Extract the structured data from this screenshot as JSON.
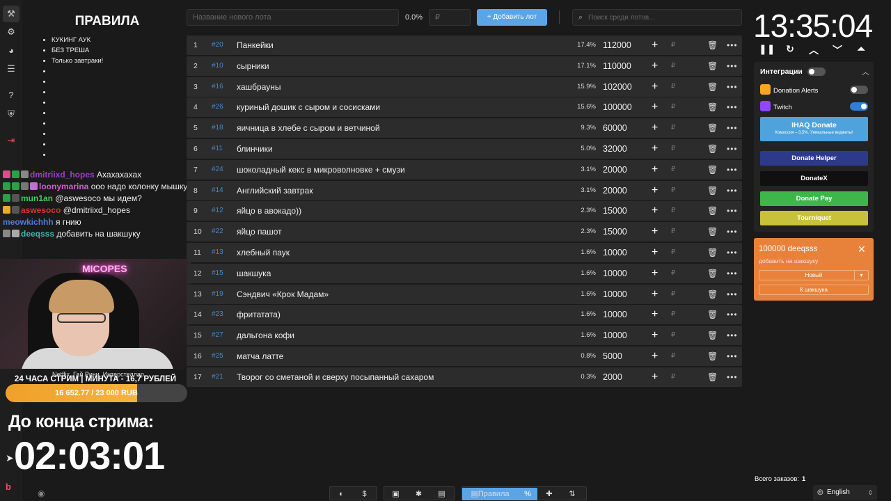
{
  "rail": [
    "hammer-icon",
    "gear-icon",
    "pie-chart-icon",
    "layers-icon",
    "help-icon",
    "shield-icon",
    "logout-icon"
  ],
  "rules": {
    "title": "ПРАВИЛА",
    "items": [
      "КУКИНГ АУК",
      "БЕЗ ТРЕША",
      "Только завтраки!",
      "",
      "",
      "",
      "",
      "",
      "",
      "",
      "",
      ""
    ]
  },
  "chat": [
    {
      "nick": "dmitriixd_hopes",
      "nick_color": "#9b3fc9",
      "text": "Ахахахахах",
      "badges": [
        "#e04b8a",
        "#2aa145",
        "#888888"
      ]
    },
    {
      "nick": "loonymarina",
      "nick_color": "#d05cd6",
      "text": "ооо надо колонку мышку",
      "badges": [
        "#2aa145",
        "#2aa145",
        "#777777",
        "#c070d0"
      ]
    },
    {
      "nick": "mun1an",
      "nick_color": "#41c85b",
      "text": "@aswesoco мы идем?",
      "badges": [
        "#2aa145",
        "#555555"
      ]
    },
    {
      "nick": "aswesoco",
      "nick_color": "#d63333",
      "text": "@dmitriixd_hopes",
      "badges": [
        "#e6b020",
        "#555555"
      ]
    },
    {
      "nick": "meowkichhh",
      "nick_color": "#4a7fd8",
      "text": "я гнию",
      "badges": []
    },
    {
      "nick": "deeqsss",
      "nick_color": "#3fb6a8",
      "text": "добавить на шакшуку",
      "badges": [
        "#888888",
        "#aaaaaa"
      ]
    }
  ],
  "cam": {
    "neon": "MICOPES",
    "now_playing": "Netflix, Гай Ричи, Интерстеллар"
  },
  "stream": {
    "title": "24 ЧАСА СТРИМ | МИНУТА - 16,7 РУБЛЕЙ",
    "goal_text": "16 652.77 / 23 000 RUB",
    "goal_progress": 0.724,
    "until_label": "До конца стрима:",
    "countdown": "02:03:01"
  },
  "topbar": {
    "lot_name_placeholder": "Название нового лота",
    "percent": "0.0%",
    "amount_placeholder": "₽",
    "add_label": "Добавить лот",
    "search_placeholder": "Поиск среди лотов..."
  },
  "lots": [
    {
      "n": "1",
      "id": "#20",
      "name": "Панкейки",
      "pct": "17.4%",
      "amount": "112000"
    },
    {
      "n": "2",
      "id": "#10",
      "name": "сырники",
      "pct": "17.1%",
      "amount": "110000"
    },
    {
      "n": "3",
      "id": "#16",
      "name": "хашбрауны",
      "pct": "15.9%",
      "amount": "102000"
    },
    {
      "n": "4",
      "id": "#26",
      "name": "куриный дошик с сыром и сосисками",
      "pct": "15.6%",
      "amount": "100000"
    },
    {
      "n": "5",
      "id": "#18",
      "name": "яичница в хлебе с сыром и ветчиной",
      "pct": "9.3%",
      "amount": "60000"
    },
    {
      "n": "6",
      "id": "#11",
      "name": "блинчики",
      "pct": "5.0%",
      "amount": "32000"
    },
    {
      "n": "7",
      "id": "#24",
      "name": "шоколадный кекс в микроволновке + смузи",
      "pct": "3.1%",
      "amount": "20000"
    },
    {
      "n": "8",
      "id": "#14",
      "name": "Английский завтрак",
      "pct": "3.1%",
      "amount": "20000"
    },
    {
      "n": "9",
      "id": "#12",
      "name": "яйцо в авокадо))",
      "pct": "2.3%",
      "amount": "15000"
    },
    {
      "n": "10",
      "id": "#22",
      "name": "яйцо пашот",
      "pct": "2.3%",
      "amount": "15000"
    },
    {
      "n": "11",
      "id": "#13",
      "name": "хлебный паук",
      "pct": "1.6%",
      "amount": "10000"
    },
    {
      "n": "12",
      "id": "#15",
      "name": "шакшука",
      "pct": "1.6%",
      "amount": "10000"
    },
    {
      "n": "13",
      "id": "#19",
      "name": "Сэндвич «Крок Мадам»",
      "pct": "1.6%",
      "amount": "10000"
    },
    {
      "n": "14",
      "id": "#23",
      "name": "фритатата)",
      "pct": "1.6%",
      "amount": "10000"
    },
    {
      "n": "15",
      "id": "#27",
      "name": "дальгона кофи",
      "pct": "1.6%",
      "amount": "10000"
    },
    {
      "n": "16",
      "id": "#25",
      "name": "матча латте",
      "pct": "0.8%",
      "amount": "5000"
    },
    {
      "n": "17",
      "id": "#21",
      "name": "Творог со сметаной и сверху посыпанный сахаром",
      "pct": "0.3%",
      "amount": "2000"
    }
  ],
  "lot_row": {
    "plus": "+",
    "currency": "₽",
    "trash": "🗑",
    "more": "•••"
  },
  "timer": {
    "clock": "13:35:04",
    "controls": [
      "pause-icon",
      "restart-icon",
      "chevron-up-icon",
      "chevron-down-icon",
      "double-up-icon"
    ]
  },
  "integrations": {
    "title": "Интеграции",
    "enabled": false,
    "services": [
      {
        "name": "Donation Alerts",
        "enabled": false,
        "color": "#f5a623"
      },
      {
        "name": "Twitch",
        "enabled": true,
        "color": "#9146ff"
      }
    ],
    "buttons": [
      {
        "label": "IHAQ Donate",
        "sub": "Комиссия – 3,5%. Уникальные виджеты!",
        "color": "#4fa3dd"
      },
      {
        "label": "Donate Helper",
        "color": "#2d3a8c"
      },
      {
        "label": "DonateX",
        "color": "#101010"
      },
      {
        "label": "Donate Pay",
        "color": "#3fb64a"
      },
      {
        "label": "Tourniquet",
        "color": "#c8c23a"
      }
    ]
  },
  "donation": {
    "title": "100000 deeqsss",
    "message": "добавить на шакшуку",
    "select_value": "Новый",
    "action": "К шакшука"
  },
  "footer": {
    "orders_label": "Всего заказов:",
    "orders_count": "1",
    "language": "English"
  },
  "toolbar": {
    "rules_label": "Правила",
    "percent_icon": "%"
  }
}
